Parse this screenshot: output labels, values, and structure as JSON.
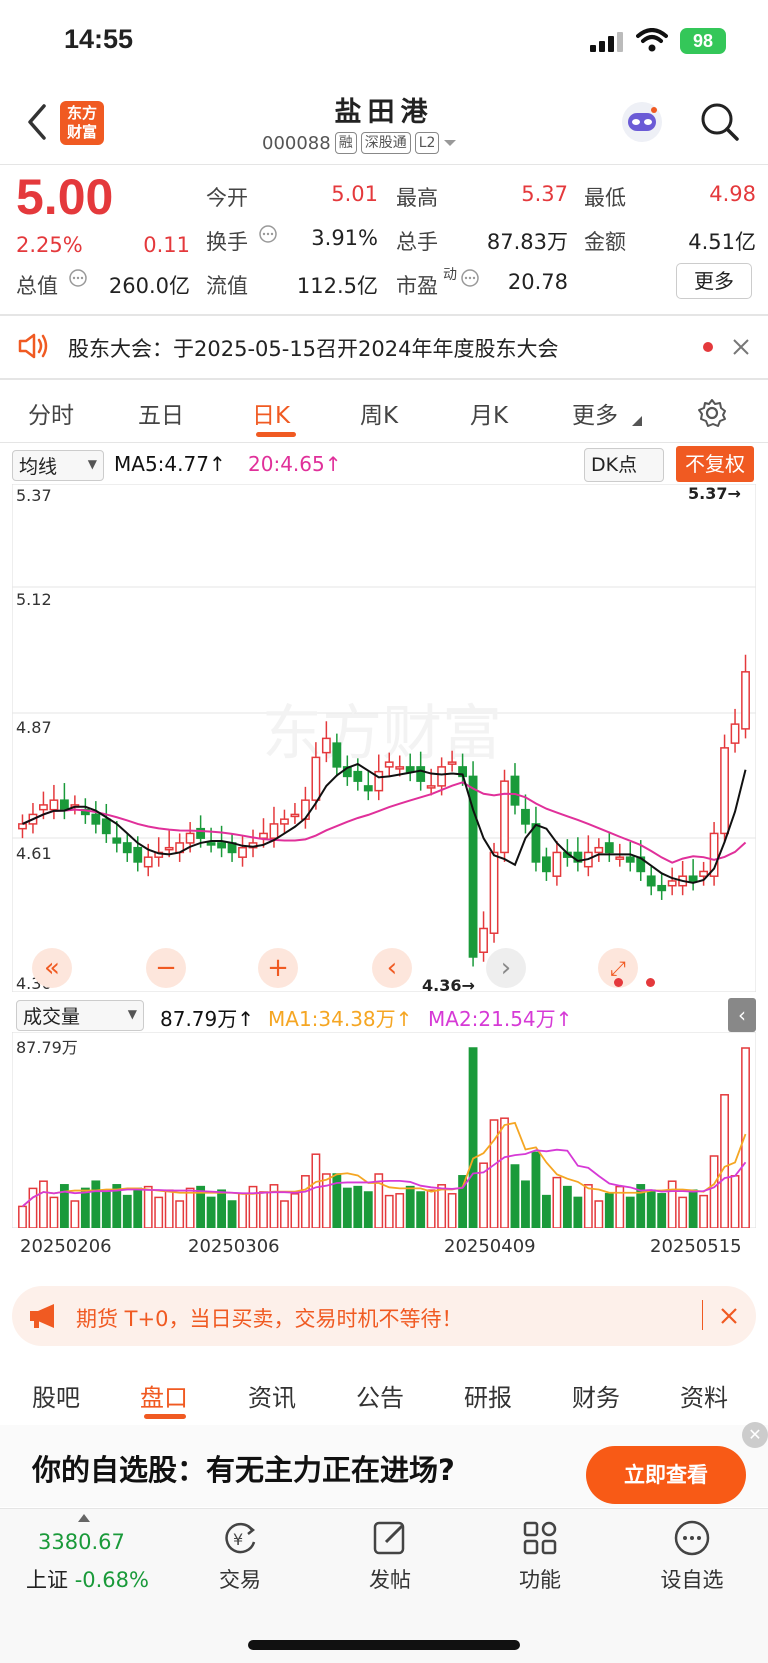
{
  "status_bar": {
    "time": "14:55",
    "battery": "98"
  },
  "header": {
    "logo_line1": "东方",
    "logo_line2": "财富",
    "name": "盐田港",
    "code": "000088",
    "tags": [
      "融",
      "深股通",
      "L2"
    ]
  },
  "quote": {
    "price": "5.00",
    "change_pct": "2.25%",
    "change": "0.11",
    "fields": {
      "open_label": "今开",
      "open": "5.01",
      "high_label": "最高",
      "high": "5.37",
      "low_label": "最低",
      "low": "4.98",
      "turnover_label": "换手",
      "turnover": "3.91%",
      "volume_label": "总手",
      "volume": "87.83万",
      "amount_label": "金额",
      "amount": "4.51亿",
      "mktcap_label": "总值",
      "mktcap": "260.0亿",
      "float_label": "流值",
      "float": "112.5亿",
      "pe_label": "市盈",
      "pe_sup": "动",
      "pe": "20.78"
    },
    "more_button": "更多"
  },
  "notice": {
    "text": "股东大会：于2025-05-15召开2024年年度股东大会"
  },
  "kline_tabs": [
    "分时",
    "五日",
    "日K",
    "周K",
    "月K",
    "更多"
  ],
  "kline_active_tab": "日K",
  "indicator_bar": {
    "select": "均线",
    "ma5": "MA5:4.77",
    "ma20": "20:4.65",
    "dk": "DK点",
    "fuquan": "不复权"
  },
  "price_axis": [
    "5.37",
    "5.12",
    "4.87",
    "4.61",
    "4.36"
  ],
  "price_markers": {
    "max": "5.37",
    "min": "4.36"
  },
  "watermark": "东方财富",
  "volume_bar": {
    "select": "成交量",
    "vol": "87.79万",
    "ma1": "MA1:34.38万",
    "ma2": "MA2:21.54万",
    "axis_top": "87.79万"
  },
  "date_axis": [
    "20250206",
    "20250306",
    "20250409",
    "20250515"
  ],
  "colors": {
    "up": "#e4393c",
    "down": "#1a9a3a",
    "ma5": "#111111",
    "ma20": "#e0309a",
    "vol_ma1": "#f5a623",
    "vol_ma2": "#d63ad6",
    "accent": "#f05a22"
  },
  "futures_banner": {
    "text": "期货 T+0，当日买卖，交易时机不等待！"
  },
  "bottom_tabs": [
    "股吧",
    "盘口",
    "资讯",
    "公告",
    "研报",
    "财务",
    "资料"
  ],
  "bottom_active_tab": "盘口",
  "promo": {
    "text": "你的自选股：有无主力正在进场?",
    "button": "立即查看"
  },
  "bottom_nav": {
    "index_value": "3380.67",
    "index_label": "上证",
    "index_change": "-0.68%",
    "items": [
      "交易",
      "发帖",
      "功能",
      "设自选"
    ]
  }
}
